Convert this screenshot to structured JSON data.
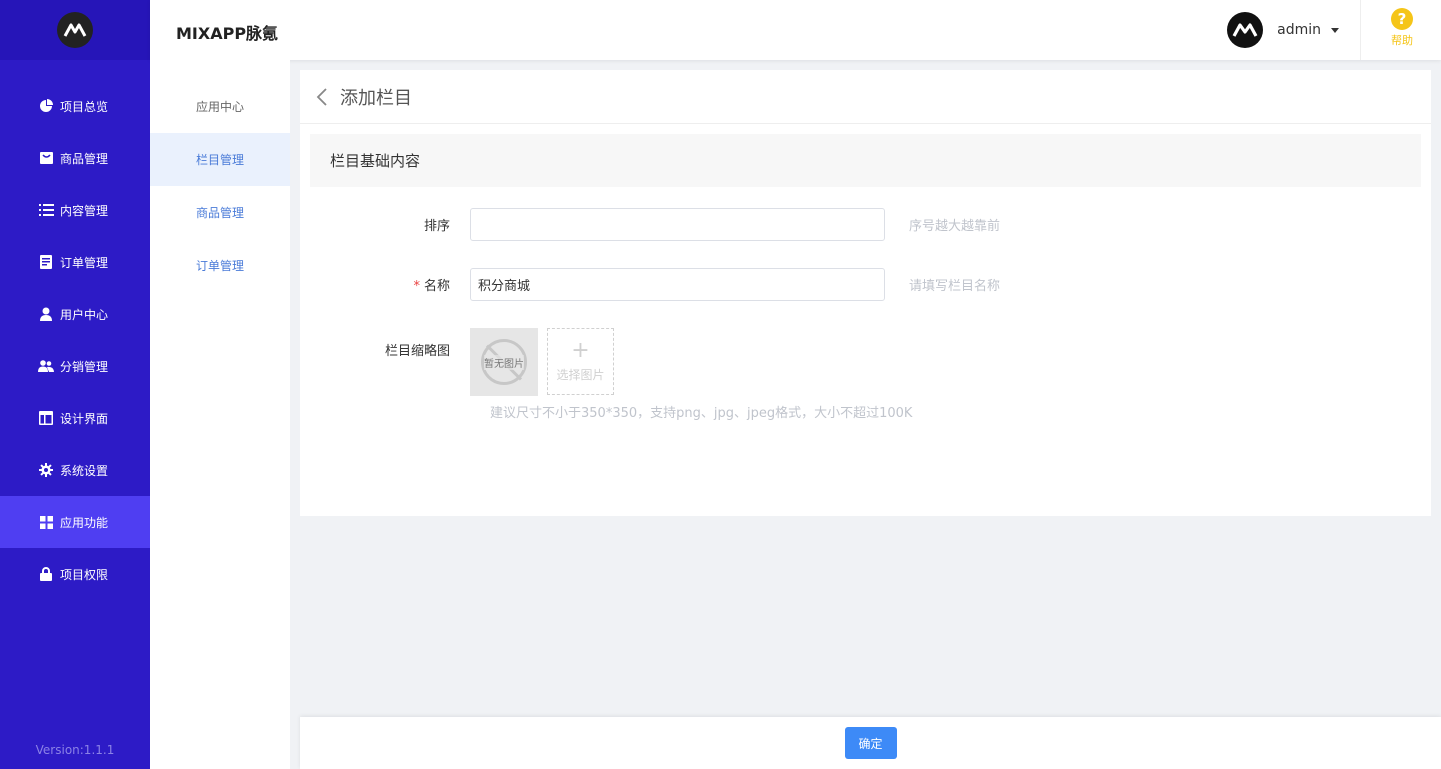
{
  "app": {
    "title": "MIXAPP脉氪",
    "version": "Version:1.1.1"
  },
  "sidebar": {
    "items": [
      {
        "label": "项目总览",
        "icon": "pie-chart-icon"
      },
      {
        "label": "商品管理",
        "icon": "bag-icon"
      },
      {
        "label": "内容管理",
        "icon": "list-icon"
      },
      {
        "label": "订单管理",
        "icon": "document-icon"
      },
      {
        "label": "用户中心",
        "icon": "user-icon"
      },
      {
        "label": "分销管理",
        "icon": "users-icon"
      },
      {
        "label": "设计界面",
        "icon": "layout-icon"
      },
      {
        "label": "系统设置",
        "icon": "gear-icon"
      },
      {
        "label": "应用功能",
        "icon": "grid-icon",
        "active": true
      },
      {
        "label": "项目权限",
        "icon": "lock-icon"
      }
    ]
  },
  "subsidebar": {
    "items": [
      {
        "label": "应用中心"
      },
      {
        "label": "栏目管理",
        "active": true
      },
      {
        "label": "商品管理"
      },
      {
        "label": "订单管理"
      }
    ]
  },
  "header": {
    "username": "admin",
    "help_label": "帮助",
    "help_glyph": "?"
  },
  "page": {
    "title": "添加栏目",
    "section_title": "栏目基础内容",
    "form": {
      "sort": {
        "label": "排序",
        "value": "",
        "hint": "序号越大越靠前"
      },
      "name": {
        "required_mark": "*",
        "label": "名称",
        "value": "积分商城",
        "hint": "请填写栏目名称"
      },
      "thumb": {
        "label": "栏目缩略图",
        "no_image_text": "暂无图片",
        "pick_plus": "+",
        "pick_label": "选择图片",
        "hint": "建议尺寸不小于350*350，支持png、jpg、jpeg格式，大小不超过100K"
      }
    }
  },
  "footer": {
    "confirm_label": "确定"
  },
  "colors": {
    "sidebar_bg": "#2d1bc6",
    "sidebar_active": "#4f3ef2",
    "primary": "#3d8af7",
    "help": "#f5c518"
  }
}
